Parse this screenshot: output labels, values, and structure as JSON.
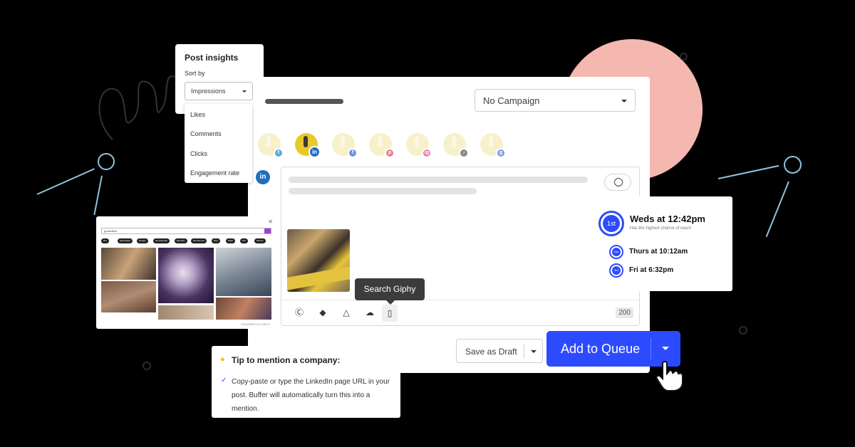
{
  "colors": {
    "accent": "#2c4bff",
    "pink_blob": "#f4b8b0",
    "line_blue": "#8fc2e0",
    "linkedin": "#1f6ebd"
  },
  "composer": {
    "campaign_value": "No Campaign",
    "profiles": [
      {
        "network": "twitter",
        "badge_color": "#5ea9dd",
        "badge_glyph": "t"
      },
      {
        "network": "linkedin",
        "badge_color": "#1f6ebd",
        "badge_glyph": "in"
      },
      {
        "network": "facebook",
        "badge_color": "#6f95d6",
        "badge_glyph": "f"
      },
      {
        "network": "pinterest",
        "badge_color": "#e87c8c",
        "badge_glyph": "p"
      },
      {
        "network": "instagram",
        "badge_color": "#f07ca8",
        "badge_glyph": "ig"
      },
      {
        "network": "tiktok",
        "badge_color": "#888888",
        "badge_glyph": "♪"
      },
      {
        "network": "google-business",
        "badge_color": "#7c9fe0",
        "badge_glyph": "g"
      }
    ],
    "linkedin_mark": "in",
    "char_count": "200",
    "tools": [
      "canva-icon",
      "dropbox-icon",
      "google-drive-icon",
      "onedrive-icon",
      "giphy-icon"
    ],
    "tooltip": "Search Giphy",
    "save_draft_label": "Save as Draft",
    "queue_label": "Add to Queue"
  },
  "insights": {
    "title": "Post insights",
    "sort_label": "Sort by",
    "selected": "Impressions",
    "options": [
      "Likes",
      "Comments",
      "Clicks",
      "Engagement rate"
    ]
  },
  "giphy": {
    "query": "goodvibes",
    "tags": [
      "#lol",
      "#goodnight",
      "#single",
      "#excitetreats",
      "#goodby",
      "#excitement",
      "#hal",
      "#light",
      "#lol",
      "#dance"
    ],
    "attribution": "POWERED BY GIPHY"
  },
  "schedule": {
    "first": {
      "badge": "1st",
      "time": "Weds at 12:42pm",
      "note": "Has the highest chance of reach"
    },
    "second": {
      "badge": "2nd",
      "time": "Thurs at 10:12am"
    },
    "third": {
      "badge": "3rd",
      "time": "Fri at 6:32pm"
    }
  },
  "tip": {
    "title": "Tip to mention a company:",
    "body": "Copy-paste or type the LinkedIn page URL in your post. Buffer will automatically turn this into a mention."
  }
}
